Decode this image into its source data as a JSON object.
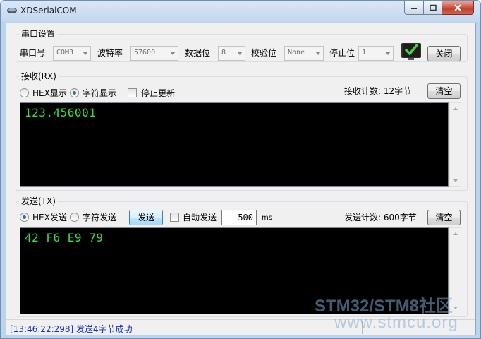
{
  "window": {
    "title": "XDSerialCOM"
  },
  "port_settings": {
    "group_label": "串口设置",
    "port_label": "串口号",
    "port_value": "COM3",
    "baud_label": "波特率",
    "baud_value": "57600",
    "databits_label": "数据位",
    "databits_value": "8",
    "parity_label": "校验位",
    "parity_value": "None",
    "stopbits_label": "停止位",
    "stopbits_value": "1",
    "status_icon": "green-check-icon",
    "close_button": "关闭"
  },
  "receive": {
    "group_label": "接收(RX)",
    "hex_display": "HEX显示",
    "char_display": "字符显示",
    "char_display_selected": true,
    "stop_update": "停止更新",
    "count_text": "接收计数: 12字节",
    "clear_button": "清空",
    "content": "123.456001"
  },
  "send": {
    "group_label": "发送(TX)",
    "hex_send": "HEX发送",
    "hex_send_selected": true,
    "char_send": "字符发送",
    "send_button": "发送",
    "auto_send": "自动发送",
    "interval_value": "500",
    "interval_unit": "ms",
    "count_text": "发送计数: 600字节",
    "clear_button": "清空",
    "content": "42 F6 E9 79"
  },
  "status_bar": {
    "message": "[13:46:22:298] 发送4字节成功"
  },
  "watermark": {
    "line1": "STM32/STM8社区",
    "line2": "www.stmcu.org"
  },
  "colors": {
    "terminal_bg": "#000000",
    "terminal_text": "#33e03a",
    "status_text": "#1530b8"
  }
}
